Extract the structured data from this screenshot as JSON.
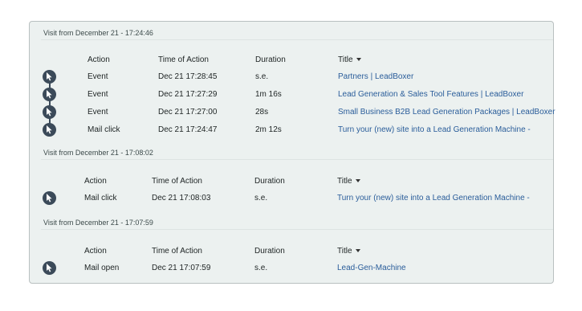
{
  "visits": [
    {
      "header": "Visit from December 21 - 17:24:46",
      "columns": {
        "action": "Action",
        "time": "Time of Action",
        "duration": "Duration",
        "title": "Title"
      },
      "rows": [
        {
          "action": "Event",
          "time": "Dec 21 17:28:45",
          "duration": "s.e.",
          "title": "Partners | LeadBoxer",
          "icon": "cursor-icon"
        },
        {
          "action": "Event",
          "time": "Dec 21 17:27:29",
          "duration": "1m 16s",
          "title": "Lead Generation & Sales Tool Features | LeadBoxer",
          "icon": "cursor-icon"
        },
        {
          "action": "Event",
          "time": "Dec 21 17:27:00",
          "duration": "28s",
          "title": "Small Business B2B Lead Generation Packages | LeadBoxer",
          "icon": "cursor-icon"
        },
        {
          "action": "Mail click",
          "time": "Dec 21 17:24:47",
          "duration": "2m 12s",
          "title": "Turn your (new) site into a Lead Generation Machine -",
          "icon": "cursor-icon"
        }
      ]
    },
    {
      "header": "Visit from December 21 - 17:08:02",
      "columns": {
        "action": "Action",
        "time": "Time of Action",
        "duration": "Duration",
        "title": "Title"
      },
      "rows": [
        {
          "action": "Mail click",
          "time": "Dec 21 17:08:03",
          "duration": "s.e.",
          "title": "Turn your (new) site into a Lead Generation Machine -",
          "icon": "cursor-icon"
        }
      ]
    },
    {
      "header": "Visit from December 21 - 17:07:59",
      "columns": {
        "action": "Action",
        "time": "Time of Action",
        "duration": "Duration",
        "title": "Title"
      },
      "rows": [
        {
          "action": "Mail open",
          "time": "Dec 21 17:07:59",
          "duration": "s.e.",
          "title": "Lead-Gen-Machine",
          "icon": "cursor-icon"
        }
      ]
    }
  ],
  "colors": {
    "panel_bg": "#ecf1f0",
    "icon_bg": "#3b4a59",
    "link": "#2a5d9a"
  }
}
